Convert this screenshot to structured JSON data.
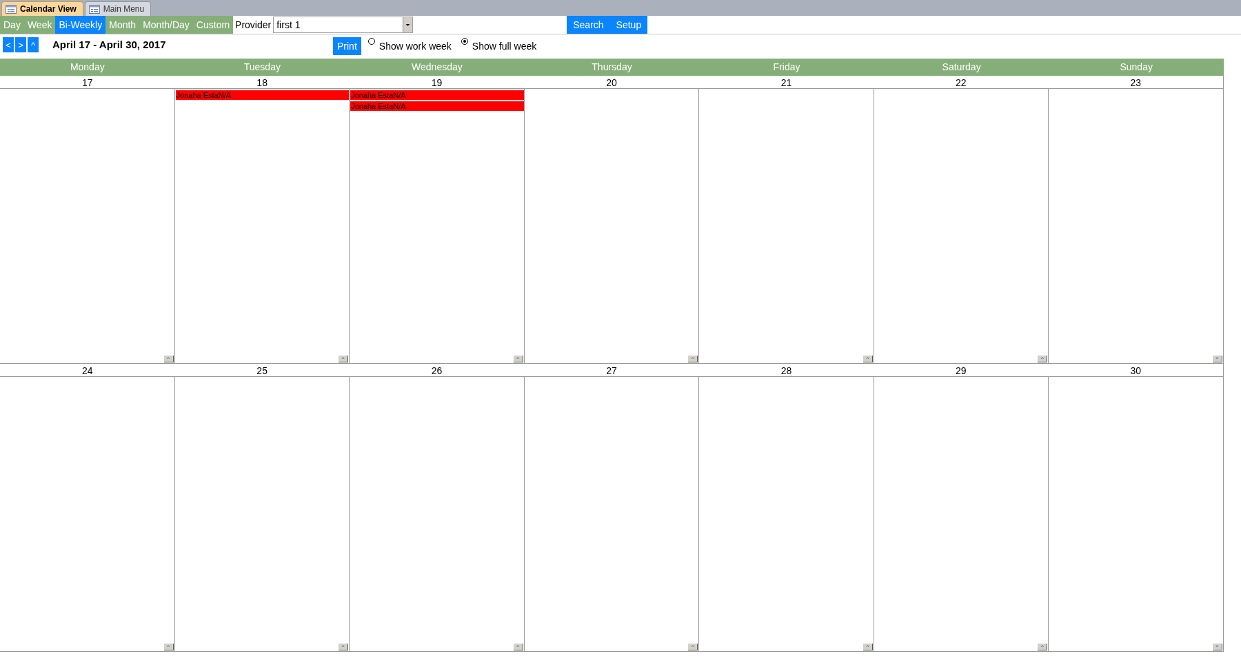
{
  "document_tabs": [
    {
      "label": "Calendar View",
      "selected": true
    },
    {
      "label": "Main Menu",
      "selected": false
    }
  ],
  "view_buttons": [
    {
      "label": "Day",
      "selected": false
    },
    {
      "label": "Week",
      "selected": false
    },
    {
      "label": "Bi-Weekly",
      "selected": true
    },
    {
      "label": "Month",
      "selected": false
    },
    {
      "label": "Month/Day",
      "selected": false
    },
    {
      "label": "Custom",
      "selected": false
    }
  ],
  "provider": {
    "label": "Provider",
    "value": "first 1"
  },
  "actions": [
    "Search",
    "Setup"
  ],
  "nav_buttons": [
    "<",
    ">",
    "^"
  ],
  "range_title": "April 17 - April 30, 2017",
  "print_button": "Print",
  "week_options": [
    {
      "label": "Show work week",
      "selected": false
    },
    {
      "label": "Show full week",
      "selected": true
    }
  ],
  "weekdays": [
    "Monday",
    "Tuesday",
    "Wednesday",
    "Thursday",
    "Friday",
    "Saturday",
    "Sunday"
  ],
  "weeks": [
    {
      "days": [
        {
          "date": "17",
          "more": "^"
        },
        {
          "date": "18",
          "events": [
            {
              "text": "Jonaha EstaN/A",
              "color": "#ff0000"
            }
          ],
          "more": "^"
        },
        {
          "date": "19",
          "events": [
            {
              "text": "Jonaha EstaN/A",
              "color": "#ff0000"
            },
            {
              "text": "Jonaha EstaN/A",
              "color": "#ff0000"
            }
          ],
          "more": "^"
        },
        {
          "date": "20",
          "more": "^"
        },
        {
          "date": "21",
          "more": "^"
        },
        {
          "date": "22",
          "more": "^"
        },
        {
          "date": "23",
          "more": "^"
        }
      ]
    },
    {
      "days": [
        {
          "date": "24",
          "more": "^"
        },
        {
          "date": "25",
          "more": "^"
        },
        {
          "date": "26",
          "more": "^"
        },
        {
          "date": "27",
          "more": "^"
        },
        {
          "date": "28",
          "more": "^"
        },
        {
          "date": "29",
          "more": "^"
        },
        {
          "date": "30",
          "more": "^"
        }
      ]
    }
  ]
}
